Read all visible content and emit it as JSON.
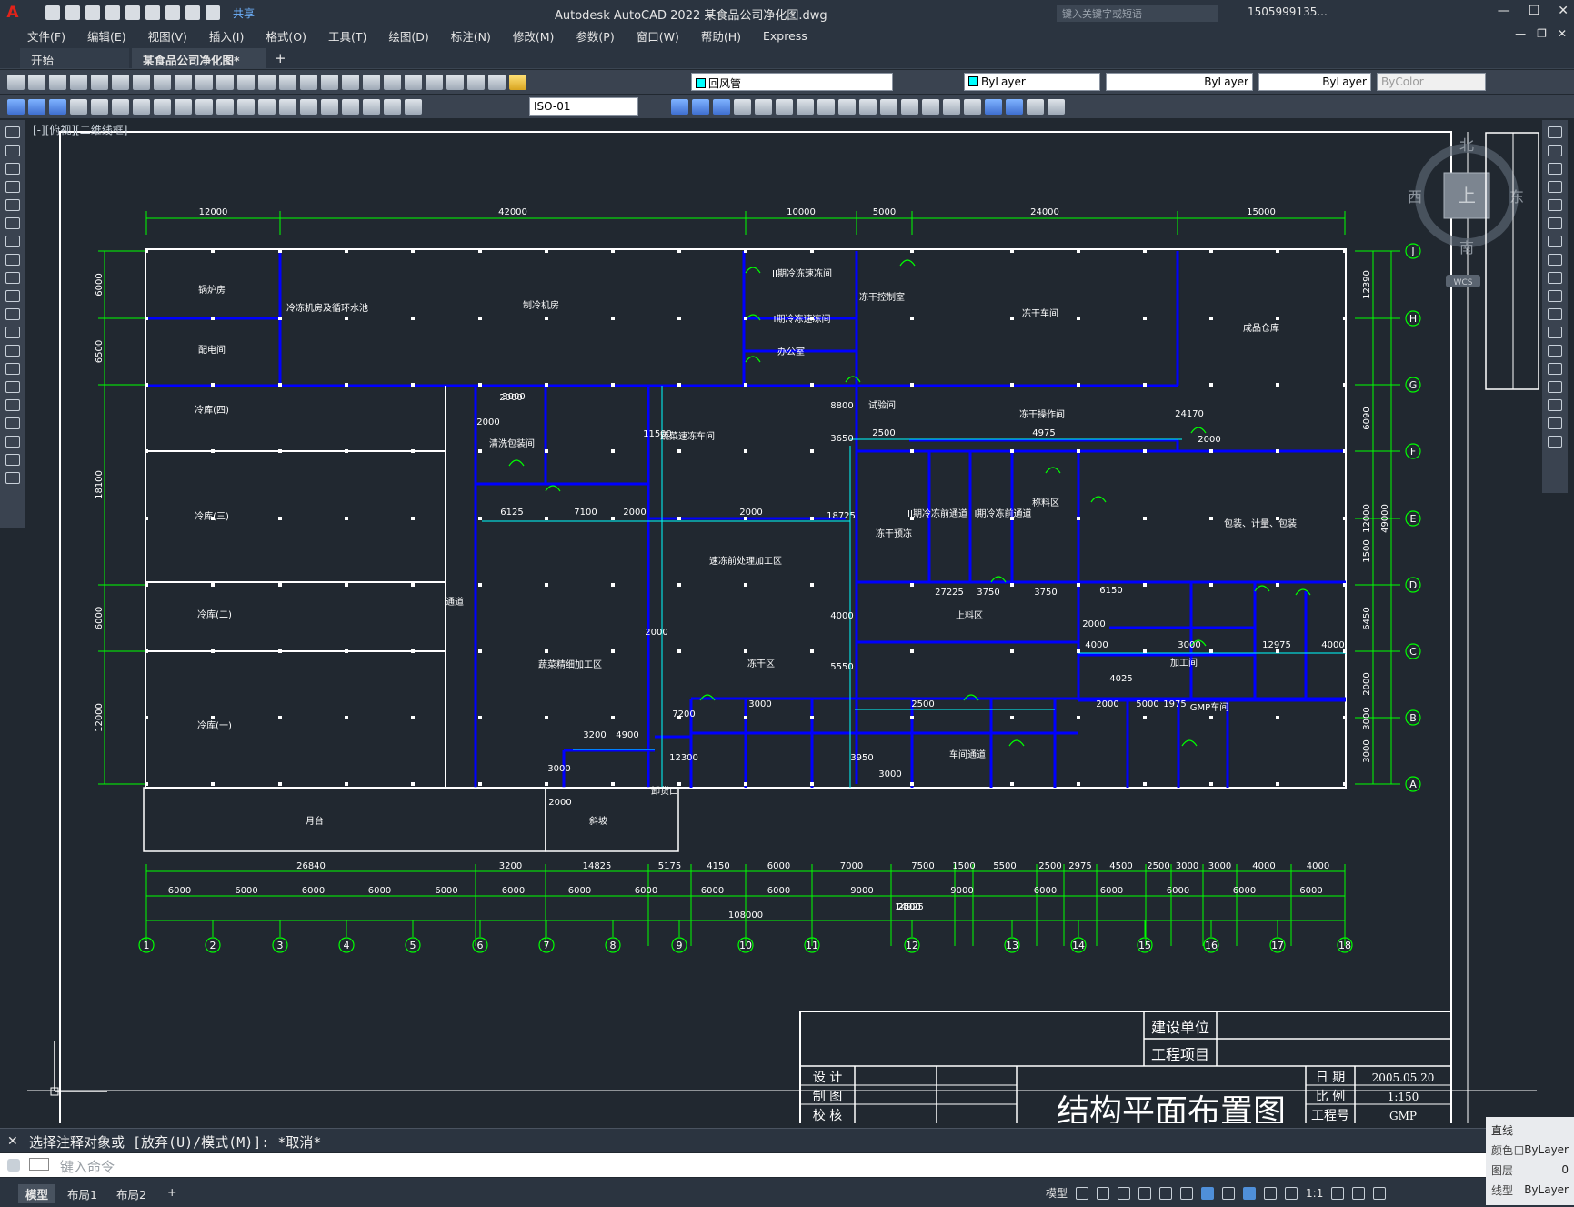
{
  "app": {
    "logo": "A",
    "title": "Autodesk AutoCAD 2022    某食品公司净化图.dwg",
    "share_label": "共享",
    "search_placeholder": "键入关键字或短语",
    "user": "1505999135...",
    "window_controls": [
      "—",
      "☐",
      "✕"
    ],
    "doc_controls": [
      "—",
      "❐",
      "✕"
    ]
  },
  "menu": [
    "文件(F)",
    "编辑(E)",
    "视图(V)",
    "插入(I)",
    "格式(O)",
    "工具(T)",
    "绘图(D)",
    "标注(N)",
    "修改(M)",
    "参数(P)",
    "窗口(W)",
    "帮助(H)",
    "Express"
  ],
  "tabs": {
    "start": "开始",
    "active": "某食品公司净化图*",
    "close": "✕",
    "add": "+"
  },
  "toolbar": {
    "layer": "回风管",
    "color": "ByLayer",
    "linetype": "ByLayer",
    "lineweight": "ByLayer",
    "plotstyle": "ByColor",
    "dimstyle": "ISO-01"
  },
  "viewcube": {
    "north": "北",
    "south": "南",
    "east": "东",
    "west": "西",
    "top": "上",
    "wcs": "WCS"
  },
  "drawing": {
    "view_label": "[-][俯视][二维线框]",
    "top_dims": [
      "12000",
      "42000",
      "10000",
      "5000",
      "24000",
      "15000"
    ],
    "left_dims": [
      "6000",
      "6500",
      "18100",
      "6000",
      "12000"
    ],
    "right_dims": [
      "12390",
      "6090",
      "12000",
      "1500",
      "6450",
      "2000",
      "3000",
      "3000"
    ],
    "right_total": "49000",
    "row_axes": [
      "J",
      "H",
      "G",
      "F",
      "E",
      "D",
      "C",
      "B",
      "A"
    ],
    "col_axes": [
      "1",
      "2",
      "3",
      "4",
      "5",
      "6",
      "7",
      "8",
      "9",
      "10",
      "11",
      "12",
      "13",
      "14",
      "15",
      "16",
      "17",
      "18"
    ],
    "bottom_dims_row1": [
      "26840",
      "3200",
      "14825",
      "5175",
      "4150",
      "6000",
      "7000",
      "7500",
      "1500",
      "5500",
      "2500",
      "2975",
      "4500",
      "2500",
      "3000",
      "3000",
      "4000",
      "4000"
    ],
    "bottom_dims_row2": [
      "6000",
      "6000",
      "6000",
      "6000",
      "6000",
      "6000",
      "6000",
      "6000",
      "6000",
      "6000",
      "9000",
      "9000",
      "6000",
      "6000",
      "6000",
      "6000",
      "6000"
    ],
    "bottom_total": "108000",
    "interior_dims": [
      "2000",
      "2000",
      "3000",
      "6125",
      "7100",
      "2000",
      "2000",
      "18725",
      "11500",
      "8800",
      "3650",
      "2500",
      "4975",
      "24170",
      "2000",
      "2000",
      "27225",
      "3750",
      "3750",
      "6150",
      "2000",
      "4000",
      "3000",
      "12975",
      "4000",
      "4000",
      "5550",
      "4025",
      "2000",
      "5000",
      "1975",
      "3000",
      "2500",
      "7200",
      "12300",
      "3200",
      "4900",
      "3000",
      "3950",
      "3000",
      "2000",
      "2500",
      "2000",
      "14925"
    ],
    "rooms": [
      "锅炉房",
      "配电间",
      "冷冻机房及循环水池",
      "制冷机房",
      "II期冷冻速冻间",
      "I期冷冻速冻间",
      "办公室",
      "冻干控制室",
      "冻干车间",
      "成品仓库",
      "冷库(四)",
      "冷库(三)",
      "冷库(二)",
      "冷库(一)",
      "通道",
      "清洗包装间",
      "蔬菜速冻车间",
      "试验间",
      "冻干操作间",
      "速冻前处理加工区",
      "蔬菜精细加工区",
      "冻干区",
      "冻干预冻",
      "车间通道",
      "称料区",
      "上料区",
      "包装、计量、包装",
      "II期冷冻前通道",
      "I期冷冻前通道",
      "加工间",
      "GMP车间",
      "月台",
      "斜坡",
      "卸货口"
    ],
    "title_block": {
      "drawing_title": "结构平面布置图",
      "left_labels": [
        "设  计",
        "制  图",
        "校  核"
      ],
      "mid_labels": [
        "建设单位",
        "工程项目"
      ],
      "right_labels": [
        "日  期",
        "比  例",
        "工程号"
      ],
      "right_values": [
        "2005.05.20",
        "1:150",
        "GMP"
      ]
    }
  },
  "command": {
    "history": "选择注释对象或 [放弃(U)/模式(M)]: *取消*",
    "placeholder": "键入命令"
  },
  "status": {
    "tabs": [
      "模型",
      "布局1",
      "布局2"
    ],
    "add": "+",
    "model_label": "模型",
    "scale": "1:1"
  },
  "quick_props": {
    "type": "直线",
    "rows": [
      {
        "key": "颜色",
        "value": "□ByLayer"
      },
      {
        "key": "图层",
        "value": "0"
      },
      {
        "key": "线型",
        "value": "ByLayer"
      }
    ]
  },
  "colors": {
    "wall": "#0000ff",
    "dim": "#00ff00",
    "text": "#ffffff",
    "frame": "#ffffff",
    "cyan": "#00ffff",
    "door": "#00ff00"
  }
}
